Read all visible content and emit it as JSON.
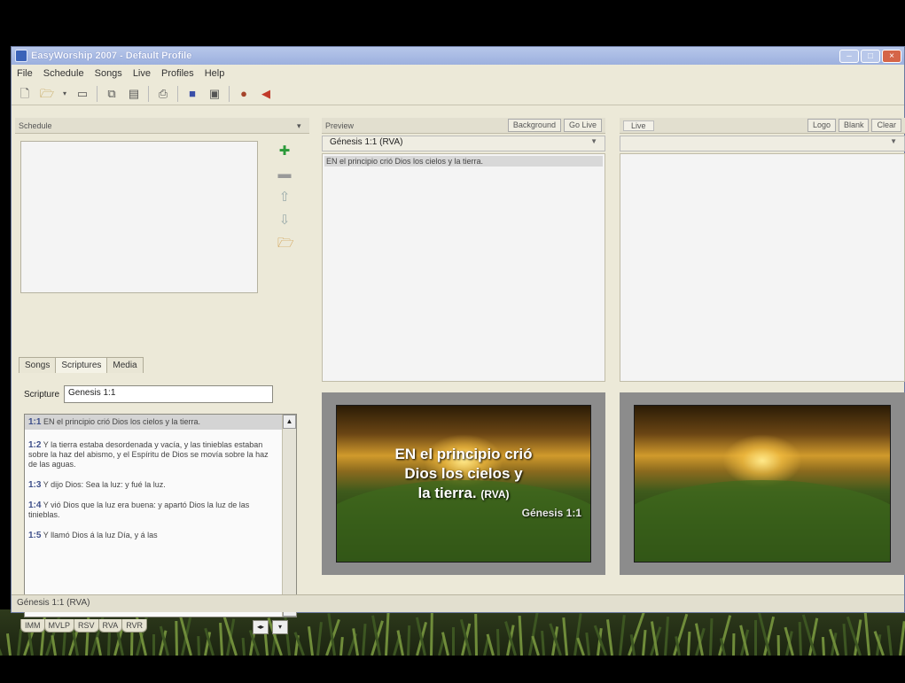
{
  "window": {
    "title": "EasyWorship 2007 - Default Profile"
  },
  "menu": [
    "File",
    "Schedule",
    "Songs",
    "Live",
    "Profiles",
    "Help"
  ],
  "toolbar": [
    "new-icon",
    "open-icon",
    "dropdown-icon",
    "save-icon",
    "copy-icon",
    "paste-icon",
    "print-icon",
    "theme-icon",
    "display-icon",
    "person-icon",
    "speaker-icon"
  ],
  "schedule": {
    "header": "Schedule"
  },
  "lower_tabs": [
    "Songs",
    "Scriptures",
    "Media"
  ],
  "scripture": {
    "label": "Scripture",
    "value": "Genesis 1:1",
    "verses": [
      {
        "ref": "1:1",
        "text": "EN el principio crió Dios los cielos y la tierra."
      },
      {
        "ref": "1:2",
        "text": "Y la tierra estaba desordenada y vacía, y las tinieblas estaban sobre la haz del abismo, y el Espíritu de Dios se movía sobre la haz de las aguas."
      },
      {
        "ref": "1:3",
        "text": "Y dijo Dios: Sea la luz: y fué la luz."
      },
      {
        "ref": "1:4",
        "text": "Y vió Dios que la luz era buena: y apartó Dios la luz de las tinieblas."
      },
      {
        "ref": "1:5",
        "text": "Y llamó Dios á la luz Día, y á las"
      }
    ],
    "versions": [
      "IMM",
      "MVLP",
      "RSV",
      "RVA",
      "RVR"
    ]
  },
  "preview": {
    "header": "Preview",
    "buttons": [
      "Background",
      "Go Live"
    ],
    "title": "Génesis 1:1 (RVA)",
    "text_line": "EN el principio crió Dios los cielos y la tierra.",
    "slide_text": [
      "EN el principio crió",
      "Dios los cielos y",
      "la tierra."
    ],
    "slide_version": "(RVA)",
    "slide_ref": "Génesis 1:1"
  },
  "live": {
    "header": "Live",
    "buttons": [
      "Logo",
      "Blank",
      "Clear"
    ]
  },
  "status": "Génesis 1:1 (RVA)"
}
